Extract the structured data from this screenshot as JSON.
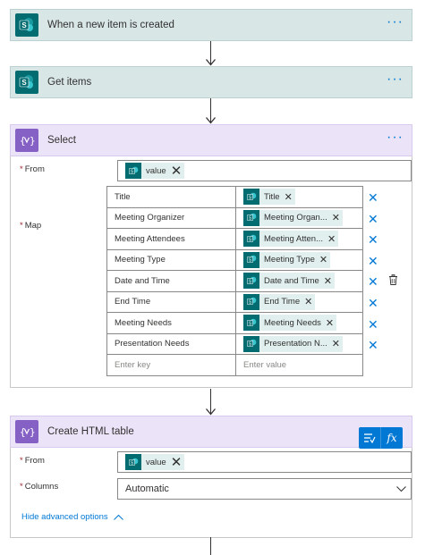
{
  "flow": {
    "trigger": {
      "title": "When a new item is created",
      "icon": "sharepoint-icon"
    },
    "get_items": {
      "title": "Get items",
      "icon": "sharepoint-icon"
    },
    "select": {
      "title": "Select",
      "icon": "data-operation-icon",
      "from_label": "From",
      "from_token": "value",
      "map_label": "Map",
      "map_rows": [
        {
          "key": "Title",
          "value": "Title"
        },
        {
          "key": "Meeting Organizer",
          "value": "Meeting Organ..."
        },
        {
          "key": "Meeting Attendees",
          "value": "Meeting Atten..."
        },
        {
          "key": "Meeting Type",
          "value": "Meeting Type"
        },
        {
          "key": "Date and Time",
          "value": "Date and Time"
        },
        {
          "key": "End Time",
          "value": "End Time"
        },
        {
          "key": "Meeting Needs",
          "value": "Meeting Needs"
        },
        {
          "key": "Presentation Needs",
          "value": "Presentation N..."
        }
      ],
      "key_placeholder": "Enter key",
      "value_placeholder": "Enter value"
    },
    "create_html": {
      "title": "Create HTML table",
      "icon": "data-operation-icon",
      "from_label": "From",
      "from_token": "value",
      "columns_label": "Columns",
      "columns_value": "Automatic",
      "advanced_link": "Hide advanced options",
      "fx_label": "fx"
    }
  },
  "required_marker": "*",
  "menu_dots": "···",
  "colors": {
    "sharepoint": "#036c70",
    "data_operation": "#8661c5",
    "link": "#0078d4",
    "required": "#a4262c"
  }
}
